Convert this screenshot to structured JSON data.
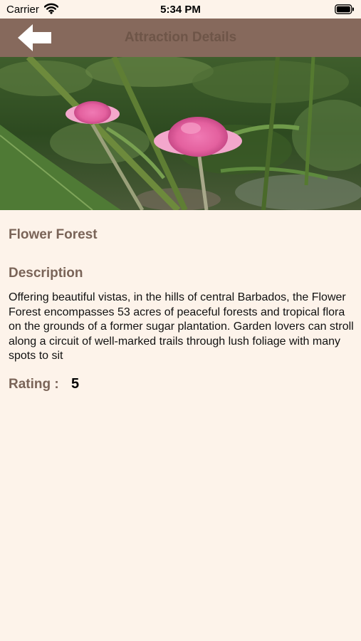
{
  "status_bar": {
    "carrier": "Carrier",
    "time": "5:34 PM",
    "icons": [
      "wifi-icon",
      "battery-icon"
    ]
  },
  "nav": {
    "title": "Attraction Details",
    "back_icon": "arrow-left-icon"
  },
  "hero": {
    "image": "photo of pink torch ginger flowers among tropical foliage"
  },
  "attraction": {
    "name": "Flower Forest",
    "description_heading": "Description",
    "description": "Offering beautiful vistas, in the hills of central Barbados, the Flower Forest encompasses 53 acres of peaceful forests and tropical flora on the grounds of a former sugar plantation. Garden lovers can stroll along a circuit of well-marked trails through lush foliage with many spots to sit",
    "rating_label": "Rating :",
    "rating_value": "5"
  },
  "colors": {
    "background": "#fdf3ea",
    "nav_bar": "#86695c",
    "nav_title": "#6e5548",
    "heading": "#7a6458"
  }
}
